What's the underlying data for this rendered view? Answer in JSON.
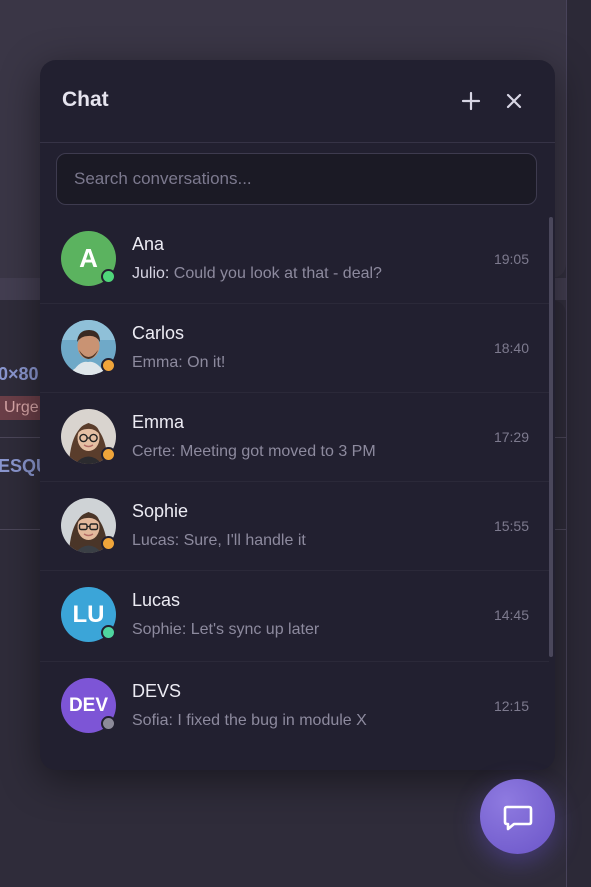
{
  "background": {
    "dimension_fragment": "0×80",
    "badge": "Urge",
    "code_fragment": "ESQU"
  },
  "chat": {
    "title": "Chat",
    "new_chat_icon": "plus-icon",
    "close_icon": "close-icon",
    "search_placeholder": "Search conversations...",
    "search_value": "",
    "conversations": [
      {
        "name": "Ana",
        "author": "Julio:",
        "message": " Could you look at that - deal?",
        "time": "19:05",
        "avatar_initials": "A",
        "avatar_color": "#5bb35f",
        "status_color": "#4fd67a",
        "author_highlight": true
      },
      {
        "name": "Carlos",
        "author": "",
        "message": "Emma: On it!",
        "time": "18:40",
        "avatar_photo": "man-photo",
        "status_color": "#f0a53a",
        "author_highlight": false
      },
      {
        "name": "Emma",
        "author": "",
        "message": "Certe: Meeting got moved to 3 PM",
        "time": "17:29",
        "avatar_photo": "woman-glasses-photo",
        "status_color": "#f0a53a",
        "author_highlight": false
      },
      {
        "name": "Sophie",
        "author": "",
        "message": "Lucas: Sure, I'll handle it",
        "time": "15:55",
        "avatar_photo": "woman-glasses-photo",
        "status_color": "#f0a53a",
        "author_highlight": false
      },
      {
        "name": "Lucas",
        "author": "",
        "message": "Sophie: Let's sync up later",
        "time": "14:45",
        "avatar_initials": "LU",
        "avatar_color": "#3ba5d8",
        "status_color": "#4fd6a0",
        "author_highlight": false
      },
      {
        "name": "DEVS",
        "author": "",
        "message": "Sofia: I fixed the bug in module X",
        "time": "12:15",
        "avatar_initials": "DEV",
        "avatar_color": "#7d55d6",
        "status_color": "#8c8a99",
        "author_highlight": false
      }
    ]
  },
  "fab": {
    "icon": "chat-bubble-icon",
    "color": "#7a66d8"
  }
}
